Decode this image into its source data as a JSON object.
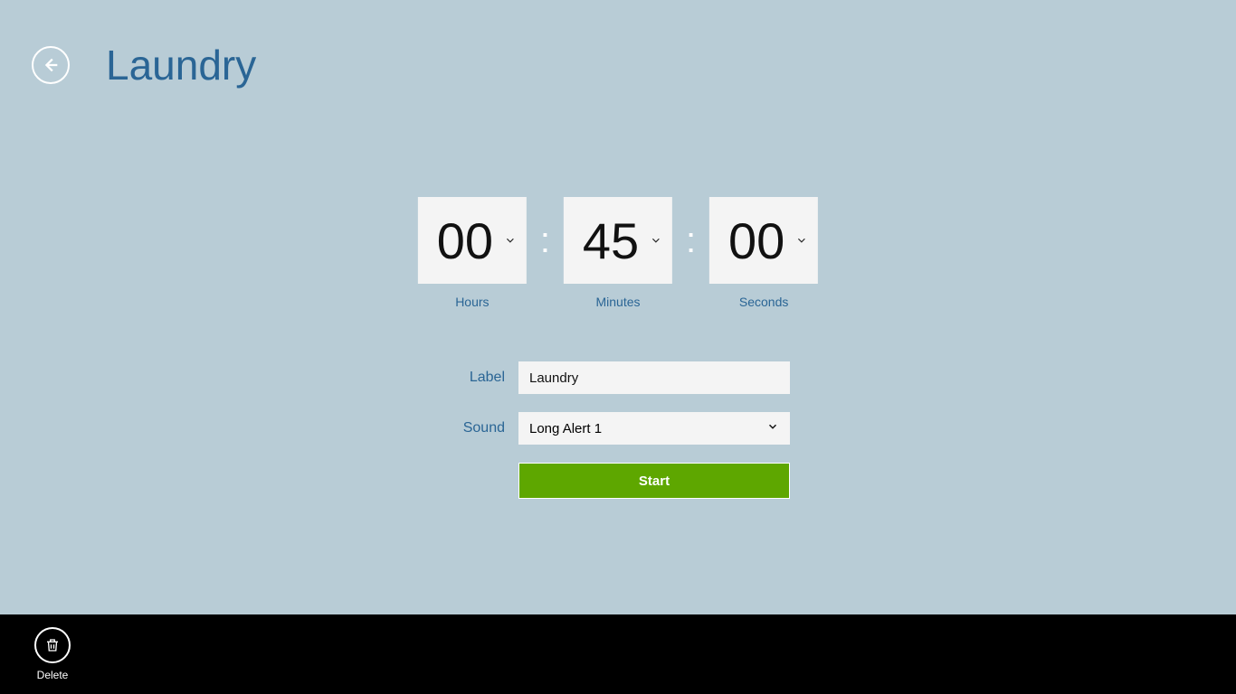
{
  "header": {
    "title": "Laundry"
  },
  "time": {
    "hours": {
      "value": "00",
      "unit": "Hours"
    },
    "minutes": {
      "value": "45",
      "unit": "Minutes"
    },
    "seconds": {
      "value": "00",
      "unit": "Seconds"
    }
  },
  "form": {
    "label_caption": "Label",
    "label_value": "Laundry",
    "sound_caption": "Sound",
    "sound_value": "Long Alert 1"
  },
  "actions": {
    "start": "Start"
  },
  "appbar": {
    "delete_label": "Delete"
  }
}
